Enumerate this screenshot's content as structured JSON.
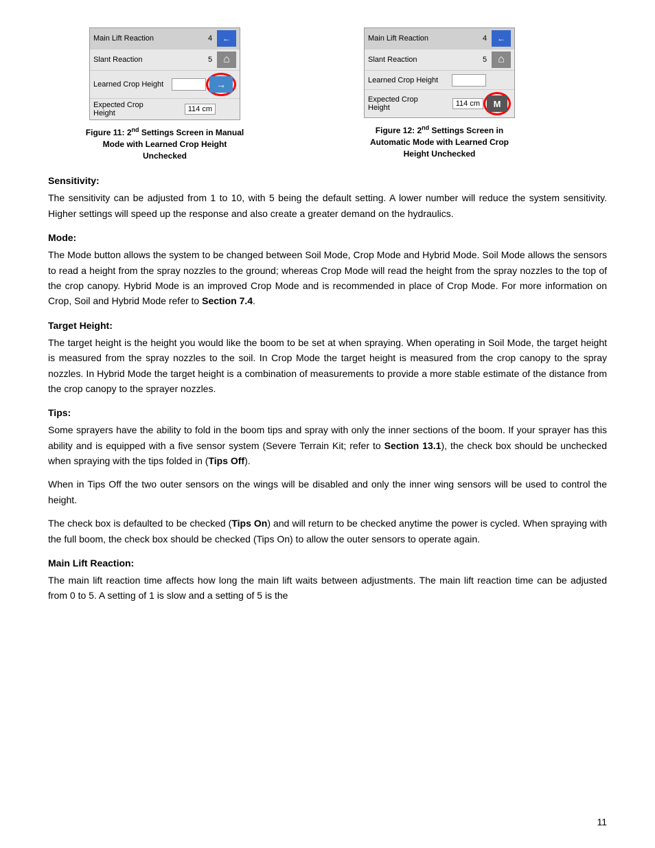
{
  "figures": [
    {
      "id": "fig11",
      "rows": [
        {
          "label": "Main Lift Reaction",
          "value": "4",
          "hasBack": true,
          "hasHouse": false
        },
        {
          "label": "Slant Reaction",
          "value": "5",
          "hasBack": false,
          "hasHouse": true
        },
        {
          "label": "Learned Crop Height",
          "hasCheckbox": true,
          "hasArrow": true,
          "circleArrow": true
        },
        {
          "label": "Expected Crop\nHeight",
          "value": "114 cm",
          "hasExtra": false
        }
      ],
      "caption": "Figure 11: 2",
      "caption_nd": "nd",
      "caption_rest": " Settings Screen in Manual Mode with Learned Crop Height Unchecked"
    },
    {
      "id": "fig12",
      "rows": [
        {
          "label": "Main Lift Reaction",
          "value": "4",
          "hasBack": true,
          "hasHouse": false
        },
        {
          "label": "Slant Reaction",
          "value": "5",
          "hasBack": false,
          "hasHouse": true
        },
        {
          "label": "Learned Crop Height",
          "hasCheckbox": true,
          "hasArrow": false
        },
        {
          "label": "Expected Crop\nHeight",
          "value": "114 cm",
          "hasM": true,
          "circleM": true
        }
      ],
      "caption": "Figure 12: 2",
      "caption_nd": "nd",
      "caption_rest": " Settings Screen in Automatic Mode with Learned Crop Height Unchecked"
    }
  ],
  "sections": [
    {
      "title": "Sensitivity:",
      "body": "The sensitivity can be adjusted from 1 to 10, with 5 being the default setting.  A lower number will reduce the system sensitivity.  Higher settings will speed up the response and also create a greater demand on the hydraulics."
    },
    {
      "title": "Mode:",
      "body": "The Mode button allows the system to be changed between Soil Mode, Crop Mode and Hybrid Mode.  Soil Mode allows the sensors to read a height from the spray nozzles to the ground; whereas Crop Mode will read the height from the spray nozzles to the top of the crop canopy.  Hybrid Mode is an improved Crop Mode and is recommended in place of Crop Mode.  For more information on Crop, Soil and Hybrid Mode refer to [[bold:Section 7.4]]."
    },
    {
      "title": "Target Height:",
      "body": "The target height is the height you would like the boom to be set at when spraying.  When operating in Soil Mode, the target height is measured from the spray nozzles to the soil.  In Crop Mode the target height is measured from the crop canopy to the spray nozzles.  In Hybrid Mode the target height is a combination of measurements to provide a more stable estimate of the distance from the crop canopy to the sprayer nozzles."
    },
    {
      "title": "Tips:",
      "body": "Some sprayers have the ability to fold in the boom tips and spray with only the inner sections of the boom.  If your sprayer has this ability and is equipped with a five sensor system (Severe Terrain Kit; refer to [[bold:Section 13.1]]), the check box should be unchecked when spraying with the tips folded in ([[bold:Tips Off]]).",
      "body2": "When in Tips Off the two outer sensors on the wings will be disabled and only the inner wing sensors will be used to control the height.",
      "body3": "The check box is defaulted to be checked ([[bold:Tips On]]) and will return to be checked anytime the power is cycled.  When spraying with the full boom, the check box should be checked (Tips On) to allow the outer sensors to operate again."
    },
    {
      "title": "Main Lift Reaction:",
      "body": "The main lift reaction time affects how long the main lift waits between adjustments.  The main lift reaction time can be adjusted from 0 to 5.  A setting of 1 is slow and a setting of 5 is the"
    }
  ],
  "page_number": "11"
}
